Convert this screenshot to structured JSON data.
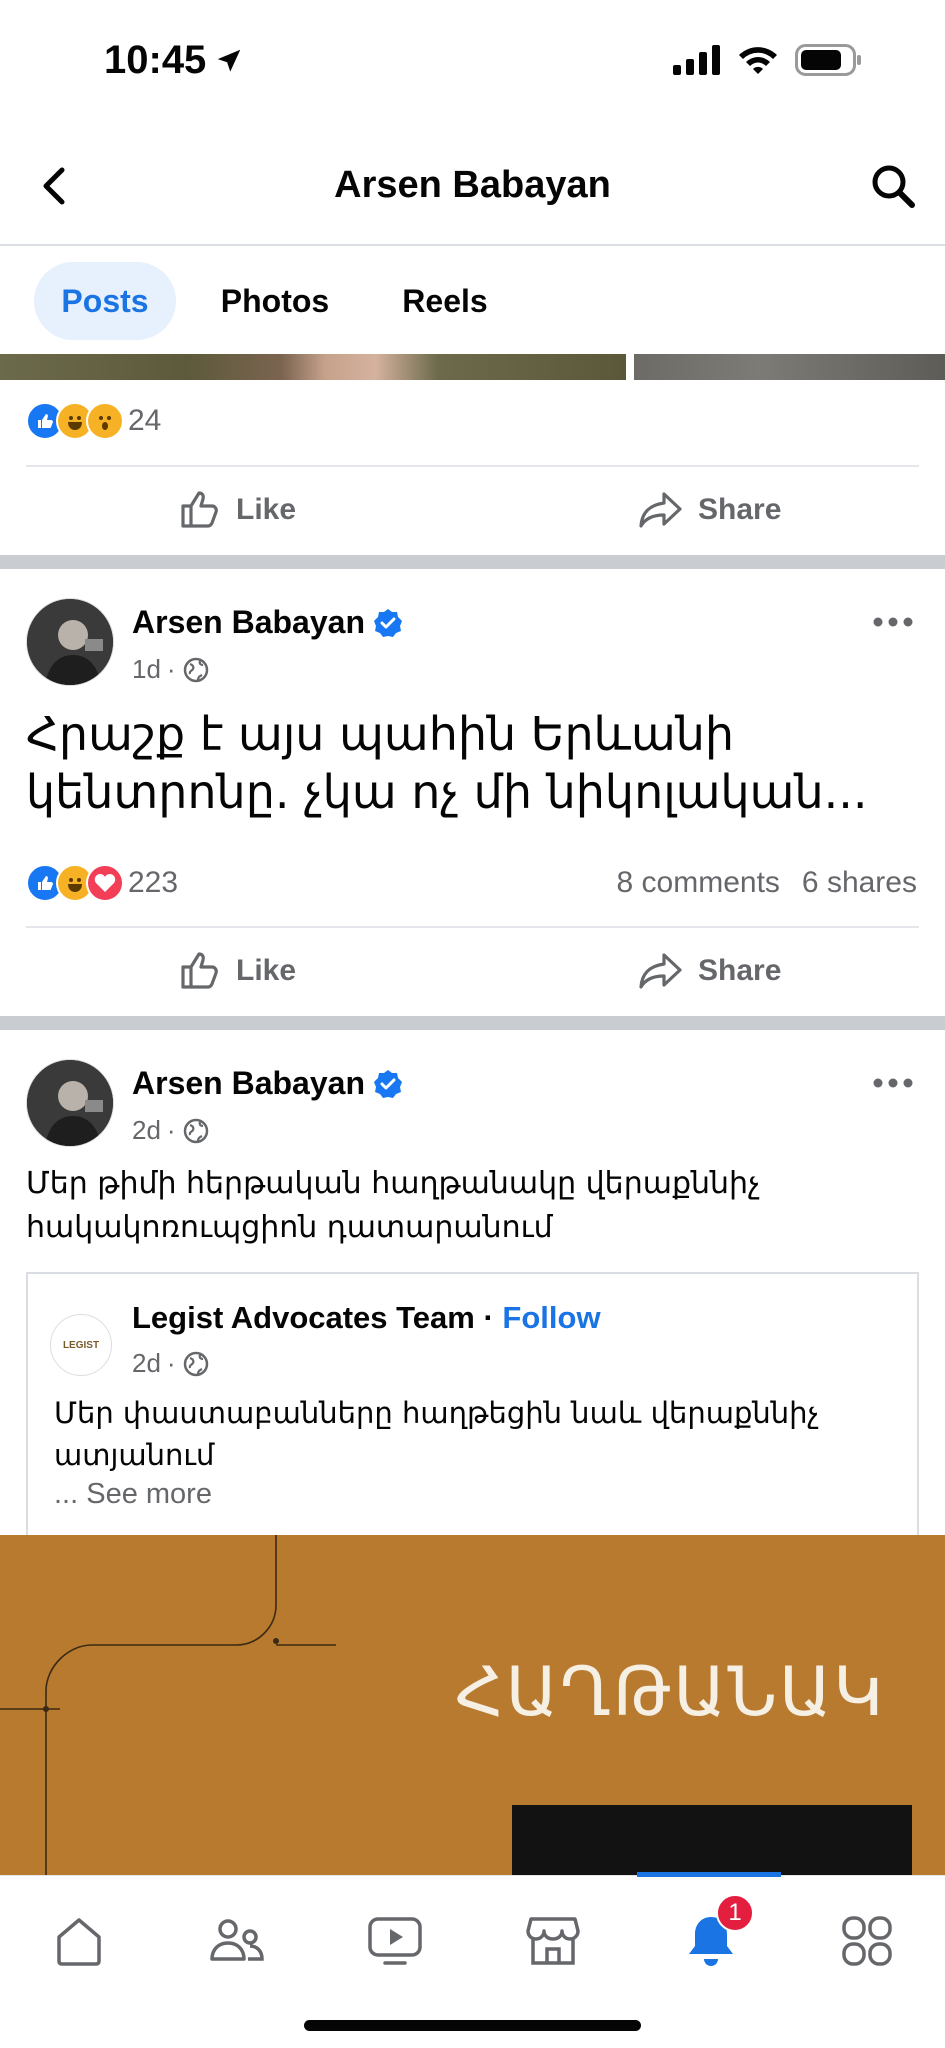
{
  "status_bar": {
    "time": "10:45"
  },
  "header": {
    "title": "Arsen Babayan"
  },
  "tabs": [
    {
      "label": "Posts",
      "active": true
    },
    {
      "label": "Photos",
      "active": false
    },
    {
      "label": "Reels",
      "active": false
    }
  ],
  "post_prev": {
    "reaction_count": "24",
    "like_label": "Like",
    "share_label": "Share"
  },
  "post1": {
    "author": "Arsen Babayan",
    "time": "1d",
    "text": "Հրաշք է այս պահին Երևանի կենտրոնը. չկա ոչ մի նիկոլական...",
    "reaction_count": "223",
    "comments": "8 comments",
    "shares": "6 shares",
    "like_label": "Like",
    "share_label": "Share"
  },
  "post2": {
    "author": "Arsen Babayan",
    "time": "2d",
    "text": "Մեր թիմի հերթական հաղթանակը վերաքննիչ հակակոռուպցիոն դատարանում",
    "shared": {
      "logo_text": "LEGIST",
      "org": "Legist Advocates Team",
      "separator": "·",
      "follow": "Follow",
      "time": "2d",
      "text": "Մեր փաստաբանները հաղթեցին նաև վերաքննիչ ատյանում",
      "see_more": "... See more"
    },
    "banner_word": "ՀԱՂԹԱՆԱԿ"
  },
  "bottom_nav": {
    "items": [
      "home-icon",
      "friends-icon",
      "video-icon",
      "marketplace-icon",
      "notifications-icon",
      "menu-icon"
    ],
    "notification_badge": "1",
    "active_index": 4
  },
  "colors": {
    "accent": "#1b74e4",
    "badge": "#e41e3f",
    "banner": "#b87a2e"
  }
}
